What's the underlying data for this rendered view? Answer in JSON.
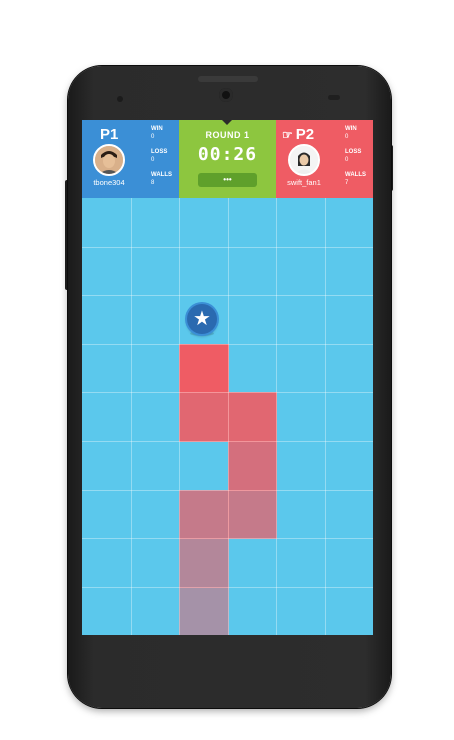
{
  "scoreboard": {
    "player1": {
      "label": "P1",
      "username": "tbone304",
      "win_label": "WIN",
      "win_value": "0",
      "loss_label": "LOSS",
      "loss_value": "0",
      "walls_label": "WALLS",
      "walls_value": "8",
      "color": "#3b8fd6"
    },
    "center": {
      "round_label": "ROUND 1",
      "timer": "00:26",
      "more_button": "•••",
      "color": "#8dc63f"
    },
    "player2": {
      "label": "P2",
      "turn_icon": "pointing-hand-icon",
      "username": "swift_fan1",
      "win_label": "WIN",
      "win_value": "0",
      "loss_label": "LOSS",
      "loss_value": "0",
      "walls_label": "WALLS",
      "walls_value": "7",
      "color": "#ef5c64"
    }
  },
  "board": {
    "columns": 6,
    "rows": 9,
    "background": "#5bc8ec",
    "token": {
      "icon": "star-icon",
      "column": 3,
      "row": 3
    },
    "walls": [
      {
        "column": 3,
        "row": 4,
        "opacity": 1.0
      },
      {
        "column": 3,
        "row": 5,
        "opacity": 0.9
      },
      {
        "column": 4,
        "row": 5,
        "opacity": 0.9
      },
      {
        "column": 4,
        "row": 6,
        "opacity": 0.82
      },
      {
        "column": 3,
        "row": 7,
        "opacity": 0.72
      },
      {
        "column": 4,
        "row": 7,
        "opacity": 0.72
      },
      {
        "column": 3,
        "row": 8,
        "opacity": 0.6
      },
      {
        "column": 3,
        "row": 9,
        "opacity": 0.5
      }
    ]
  }
}
